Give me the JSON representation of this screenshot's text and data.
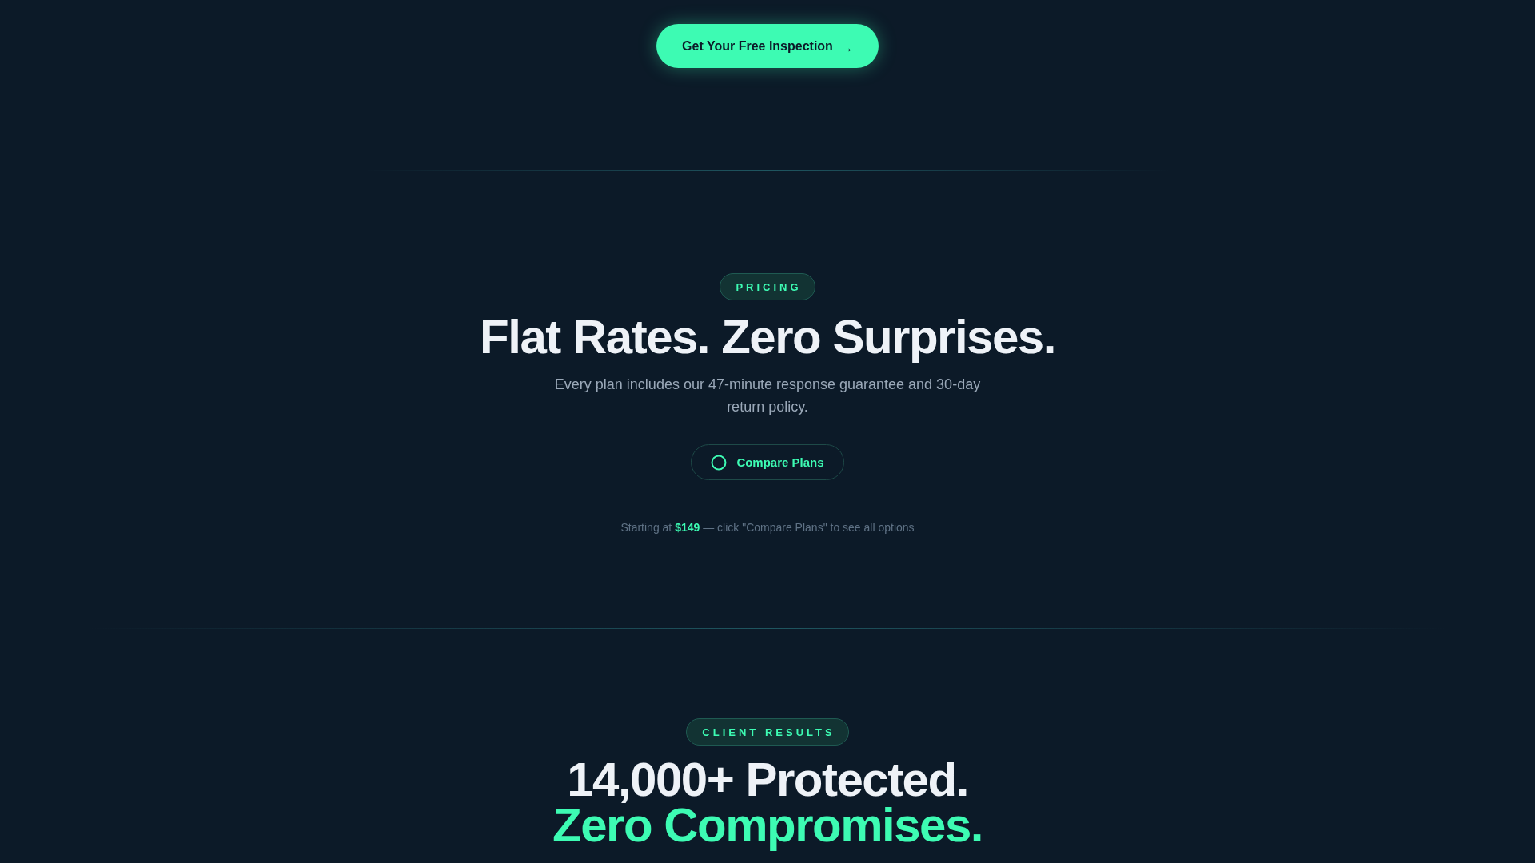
{
  "cta": {
    "label": "Get Your Free Inspection",
    "icon": "→"
  },
  "pricing": {
    "badge": "PRICING",
    "title": "Flat Rates. Zero Surprises.",
    "subtitle": "Every plan includes our 47-minute response guarantee and 30-day return policy.",
    "button": {
      "label": "Compare Plans"
    },
    "note": "Starting at **$149** — click \"Compare Plans\" to see all options"
  },
  "results": {
    "badge": "CLIENT RESULTS",
    "title_lines": [
      {
        "text": "14,000+ Protected.",
        "accent": false
      },
      {
        "text": "Zero Compromises.",
        "accent": true
      }
    ]
  }
}
